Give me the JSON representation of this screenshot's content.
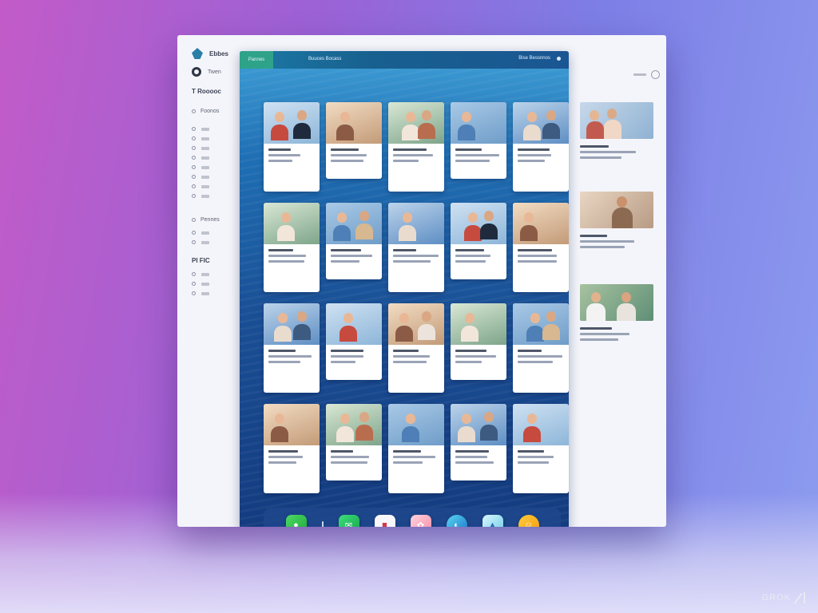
{
  "sidebar": {
    "brand": "Ebbes",
    "account": "Twen",
    "section_1": "T Rooooc",
    "section_1_item": "Foonos",
    "nav_group_1_count": 8,
    "section_2": "Pennes",
    "section_3": "PI FIC",
    "nav_group_2_count": 3
  },
  "topbar": {
    "active_tab": "Pannes",
    "tab_2": "Buuces Bocass",
    "right_label": "Bise Bessnnos"
  },
  "cards_per_row": 5,
  "card_rows": 4,
  "dock": {
    "apps": [
      "green-app-icon",
      "green-app-icon",
      "white-app-icon",
      "pink-app-icon",
      "teal-app-icon",
      "cyan-app-icon",
      "orange-app-icon"
    ]
  },
  "colors": {
    "panel_top": "#3f9fd6",
    "panel_bottom": "#143b7f",
    "active_tab": "#2fa38a",
    "background_left": "#c25bc8",
    "background_right": "#8d9cef"
  },
  "watermark": {
    "text": "GROK"
  }
}
